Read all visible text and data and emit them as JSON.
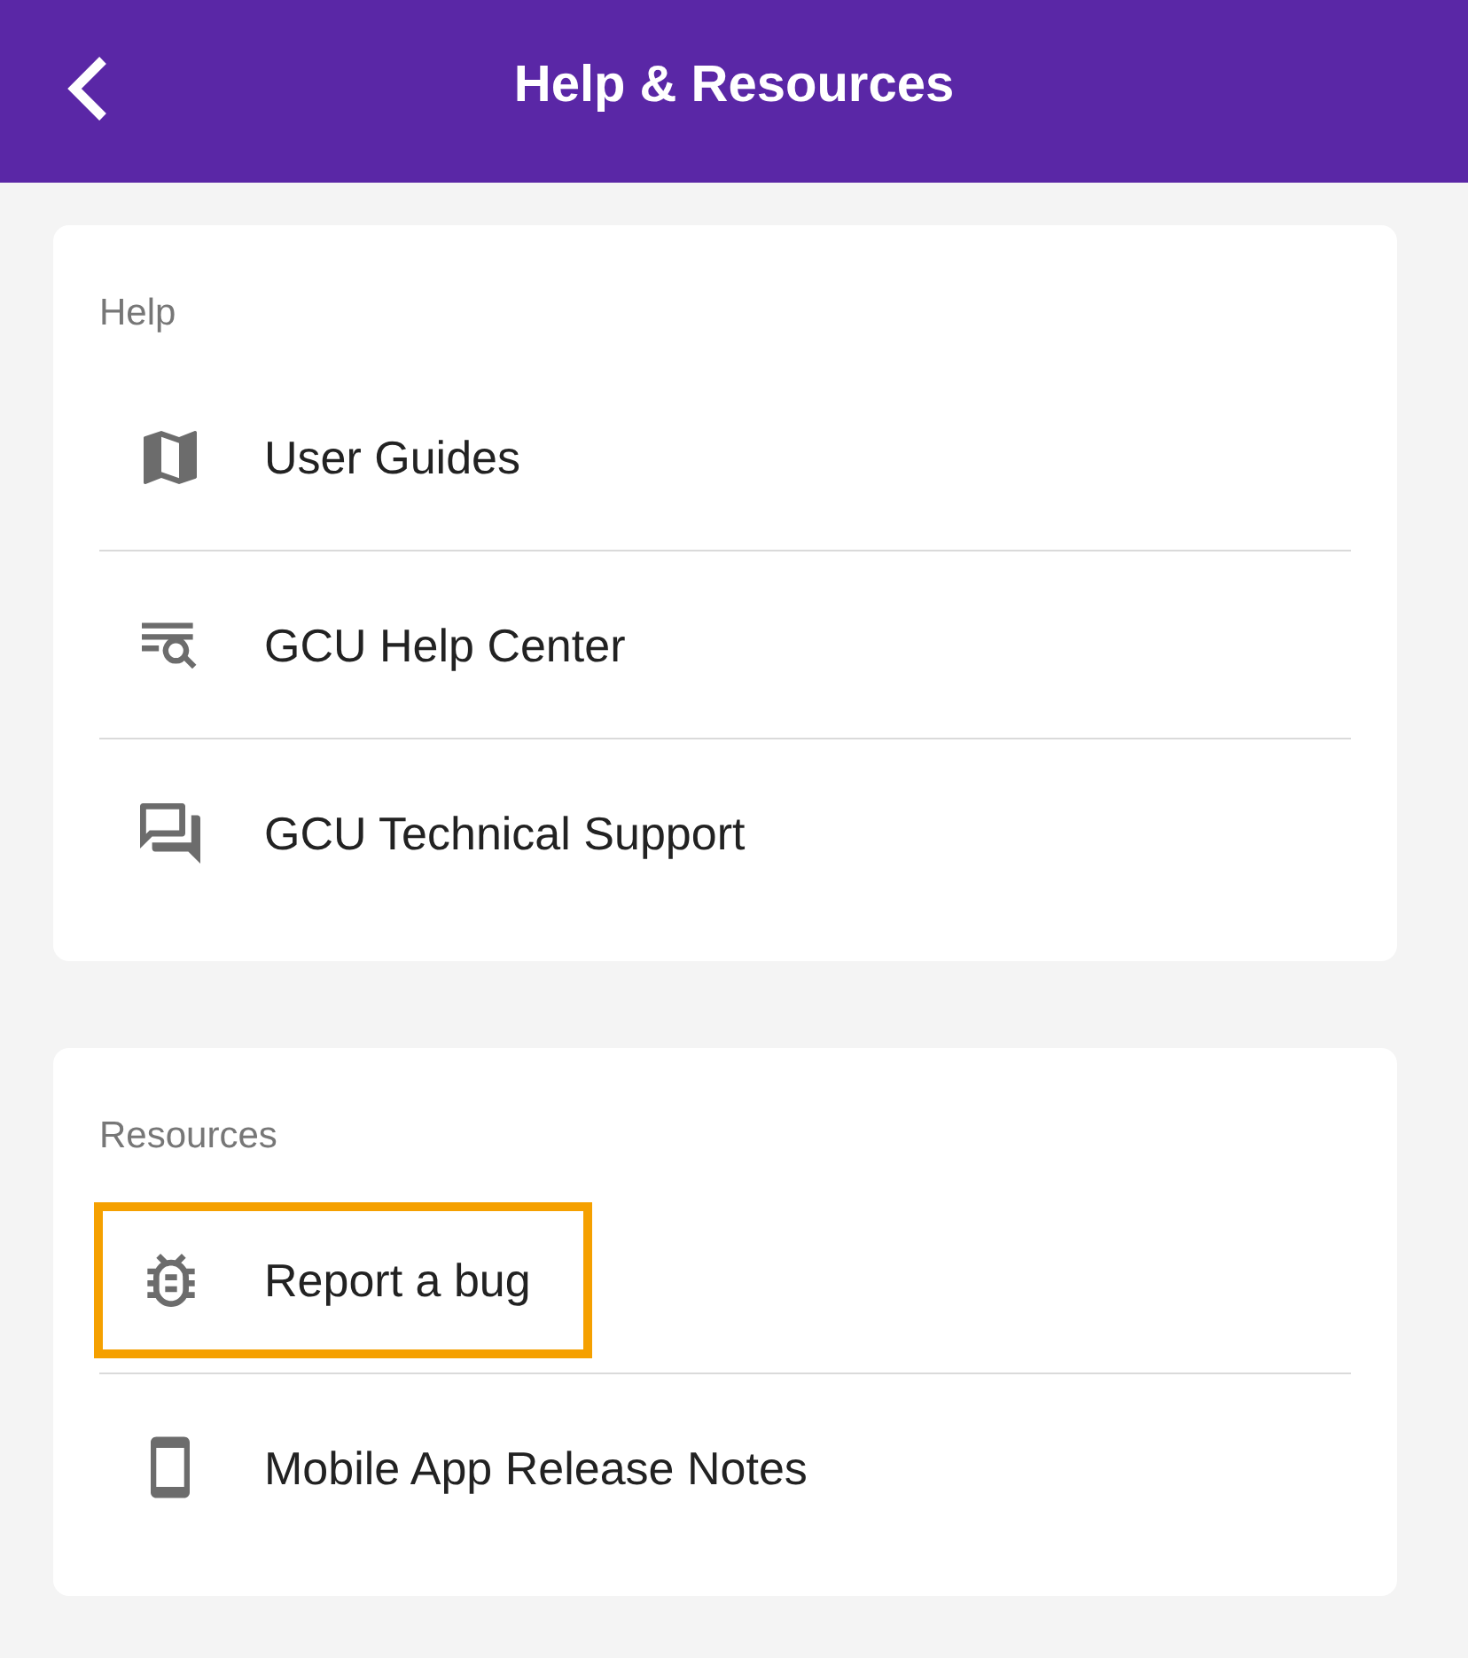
{
  "header": {
    "title": "Help & Resources"
  },
  "sections": [
    {
      "label": "Help",
      "items": [
        {
          "label": "User Guides",
          "highlighted": false
        },
        {
          "label": "GCU Help Center",
          "highlighted": false
        },
        {
          "label": "GCU Technical Support",
          "highlighted": false
        }
      ]
    },
    {
      "label": "Resources",
      "items": [
        {
          "label": "Report a bug",
          "highlighted": true
        },
        {
          "label": "Mobile App Release Notes",
          "highlighted": false
        }
      ]
    }
  ]
}
